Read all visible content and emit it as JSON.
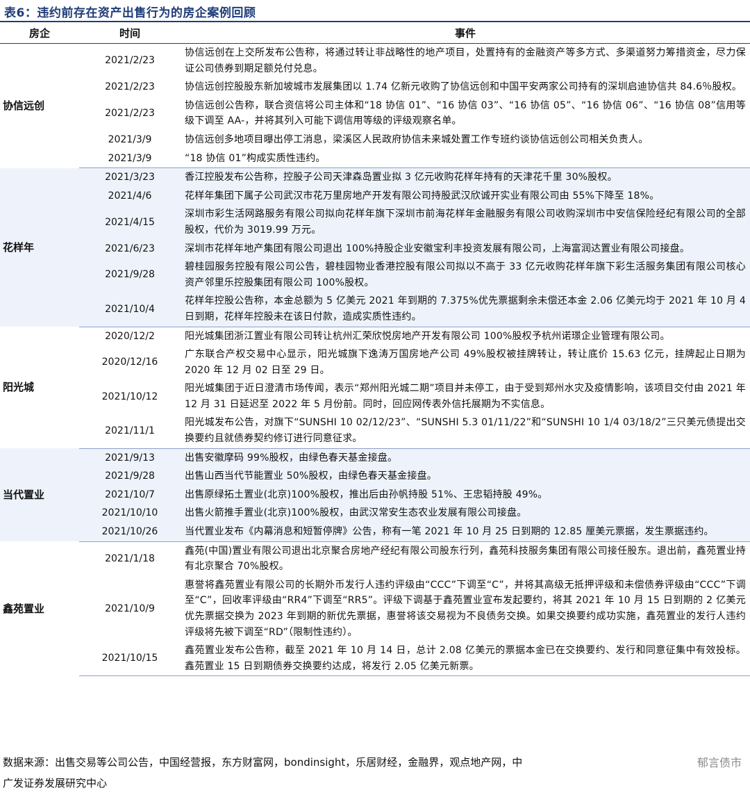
{
  "title": "表6：违约前存在资产出售行为的房企案例回顾",
  "headers": [
    "房企",
    "时间",
    "事件"
  ],
  "groups": [
    {
      "company": "协信远创",
      "rows": [
        {
          "date": "2021/2/23",
          "event": "协信远创在上交所发布公告称，将通过转让非战略性的地产项目，处置持有的金融资产等多方式、多渠道努力筹措资金，尽力保证公司债券到期足额兑付兑息。"
        },
        {
          "date": "2021/2/23",
          "event": "协信远创控股股东新加坡城市发展集团以 1.74 亿新元收购了协信远创和中国平安两家公司持有的深圳启迪协信共 84.6％股权。"
        },
        {
          "date": "2021/2/23",
          "event": "协信远创公告称，联合资信将公司主体和“18 协信 01”、“16 协信 03”、“16 协信 05”、“16 协信 06”、“16 协信 08”信用等级下调至 AA-，并将其列入可能下调信用等级的评级观察名单。"
        },
        {
          "date": "2021/3/9",
          "event": "协信远创多地项目曝出停工消息，梁溪区人民政府协信未来城处置工作专班约谈协信远创公司相关负责人。"
        },
        {
          "date": "2021/3/9",
          "event": "“18 协信 01”构成实质性违约。"
        }
      ]
    },
    {
      "company": "花样年",
      "rows": [
        {
          "date": "2021/3/23",
          "event": "香江控股发布公告称，控股子公司天津森岛置业拟 3 亿元收购花样年持有的天津花千里 30%股权。"
        },
        {
          "date": "2021/4/6",
          "event": "花样年集团下属子公司武汉市花万里房地产开发有限公司持股武汉欣诚开实业有限公司由 55%下降至 18%。"
        },
        {
          "date": "2021/4/15",
          "event": "深圳市彩生活网路服务有限公司拟向花样年旗下深圳市前海花样年金融服务有限公司收购深圳市中安信保险经纪有限公司的全部股权，代价为 3019.99 万元。"
        },
        {
          "date": "2021/6/23",
          "event": "深圳市花样年地产集团有限公司退出 100%持股企业安徽宝利丰投资发展有限公司，上海富润达置业有限公司接盘。"
        },
        {
          "date": "2021/9/28",
          "event": "碧桂园服务控股有限公司公告，碧桂园物业香港控股有限公司拟以不高于 33 亿元收购花样年旗下彩生活服务集团有限公司核心资产邻里乐控股集团有限公司 100%股权。"
        },
        {
          "date": "2021/10/4",
          "event": "花样年控股公告称，本金总额为 5 亿美元 2021 年到期的 7.375%优先票据剩余未偿还本金 2.06 亿美元均于 2021 年 10 月 4 日到期，花样年控股未在该日付款，造成实质性违约。"
        }
      ]
    },
    {
      "company": "阳光城",
      "rows": [
        {
          "date": "2020/12/2",
          "event": "阳光城集团浙江置业有限公司转让杭州汇荣欣悦房地产开发有限公司 100%股权予杭州诺璟企业管理有限公司。"
        },
        {
          "date": "2020/12/16",
          "event": "广东联合产权交易中心显示，阳光城旗下逸涛万国房地产公司 49%股权被挂牌转让，转让底价 15.63 亿元，挂牌起止日期为 2020 年 12 月 02 日至 29 日。"
        },
        {
          "date": "2021/10/12",
          "event": "阳光城集团于近日澄清市场传闻，表示“郑州阳光城二期”项目并未停工，由于受到郑州水灾及疫情影响，该项目交付由 2021 年 12 月 31 日延迟至 2022 年 5 月份前。同时，回应网传表外信托展期为不实信息。"
        },
        {
          "date": "2021/11/1",
          "event": "阳光城发布公告，对旗下“SUNSHI 10 02/12/23”、“SUNSHI 5.3 01/11/22”和“SUNSHI 10 1/4 03/18/2”三只美元债提出交换要约且就债券契约修订进行同意征求。"
        }
      ]
    },
    {
      "company": "当代置业",
      "rows": [
        {
          "date": "2021/9/13",
          "event": "出售安徽摩码 99%股权，由绿色春天基金接盘。"
        },
        {
          "date": "2021/9/28",
          "event": "出售山西当代节能置业 50%股权，由绿色春天基金接盘。"
        },
        {
          "date": "2021/10/7",
          "event": "出售原绿拓土置业(北京)100%股权，推出后由孙帆持股 51%、王忠韬持股 49%。"
        },
        {
          "date": "2021/10/10",
          "event": "出售火箭推手置业(北京)100%股权，由武汉常安生态农业发展有限公司接盘。"
        },
        {
          "date": "2021/10/26",
          "event": "当代置业发布《内幕消息和短暂停牌》公告，称有一笔 2021 年 10 月 25 日到期的 12.85 厘美元票据，发生票据违约。"
        }
      ]
    },
    {
      "company": "鑫苑置业",
      "rows": [
        {
          "date": "2021/1/18",
          "event": "鑫苑(中国)置业有限公司退出北京聚合房地产经纪有限公司股东行列，鑫苑科技服务集团有限公司接任股东。退出前，鑫苑置业持有北京聚合 70%股权。"
        },
        {
          "date": "2021/10/9",
          "event": "惠誉将鑫苑置业有限公司的长期外币发行人违约评级由“CCC”下调至“C”，并将其高级无抵押评级和未偿债券评级由“CCC”下调至“C”，回收率评级由“RR4”下调至“RR5”。评级下调基于鑫苑置业宣布发起要约，将其 2021 年 10 月 15 日到期的 2 亿美元优先票据交换为 2023 年到期的新优先票据，惠誉将该交易视为不良债务交换。如果交换要约成功实施，鑫苑置业的发行人违约评级将先被下调至“RD”（限制性违约）。"
        },
        {
          "date": "2021/10/15",
          "event": "鑫苑置业发布公告称，截至 2021 年 10 月 14 日，总计 2.08 亿美元的票据本金已在交换要约、发行和同意征集中有效投标。鑫苑置业 15 日到期债券交换要约达成，将发行 2.05 亿美元新票。"
        }
      ]
    }
  ],
  "footer": {
    "source_line1": "数据来源：出售交易等公司公告，中国经营报，东方财富网，bondinsight，乐居财经，金融界，观点地产网，中",
    "source_line2": "广发证券发展研究中心",
    "watermark": "郁言债市"
  }
}
